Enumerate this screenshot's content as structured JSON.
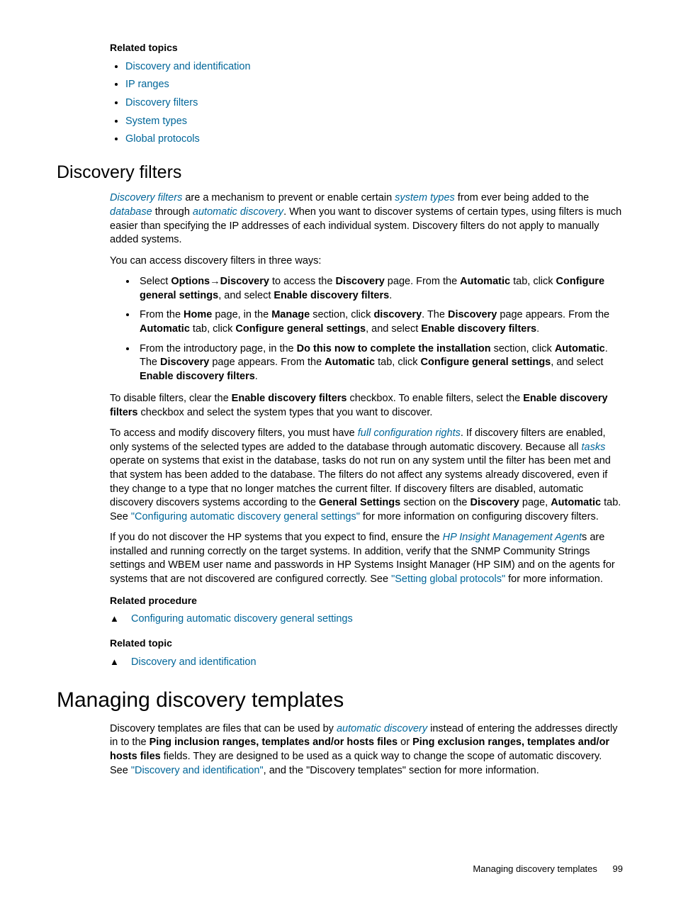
{
  "relatedTopicsHead": "Related topics",
  "topics": {
    "t0": "Discovery and identification",
    "t1": "IP ranges",
    "t2": "Discovery filters",
    "t3": "System types",
    "t4": "Global protocols"
  },
  "h_discoveryFilters": "Discovery filters",
  "df": {
    "p1_pre": "",
    "g_discoveryFilters": "Discovery filters",
    "p1_a": " are a mechanism to prevent or enable certain ",
    "g_systemTypes": "system types",
    "p1_b": " from ever being added to the ",
    "g_database": "database",
    "p1_c": " through ",
    "g_autoDisc": "automatic discovery",
    "p1_d": ". When you want to discover systems of certain types, using filters is much easier than specifying the IP addresses of each individual system. Discovery filters do not apply to manually added systems.",
    "p2": "You can access discovery filters in three ways:",
    "li1_a": "Select ",
    "li1_b1": "Options",
    "li1_arrow": "→",
    "li1_b2": "Discovery",
    "li1_c": " to access the ",
    "li1_b3": "Discovery",
    "li1_d": " page. From the ",
    "li1_b4": "Automatic",
    "li1_e": " tab, click ",
    "li1_b5": "Configure general settings",
    "li1_f": ", and select ",
    "li1_b6": "Enable discovery filters",
    "li1_g": ".",
    "li2_a": "From the ",
    "li2_b1": "Home",
    "li2_b": " page, in the ",
    "li2_b2": "Manage",
    "li2_c": " section, click ",
    "li2_b3": "discovery",
    "li2_d": ". The ",
    "li2_b4": "Discovery",
    "li2_e": " page appears. From the ",
    "li2_b5": "Automatic",
    "li2_f": " tab, click ",
    "li2_b6": "Configure general settings",
    "li2_g": ", and select ",
    "li2_b7": "Enable discovery filters",
    "li2_h": ".",
    "li3_a": "From the introductory page, in the ",
    "li3_b1": "Do this now to complete the installation",
    "li3_b": " section, click ",
    "li3_b2": "Automatic",
    "li3_c": ". The ",
    "li3_b3": "Discovery",
    "li3_d": " page appears. From the ",
    "li3_b4": "Automatic",
    "li3_e": " tab, click ",
    "li3_b5": "Configure general settings",
    "li3_f": ", and select ",
    "li3_b6": "Enable discovery filters",
    "li3_g": ".",
    "p3_a": "To disable filters, clear the ",
    "p3_b1": "Enable discovery filters",
    "p3_b": " checkbox. To enable filters, select the ",
    "p3_b2": "Enable discovery filters",
    "p3_c": " checkbox and select the system types that you want to discover.",
    "p4_a": "To access and modify discovery filters, you must have ",
    "p4_g1": "full configuration rights",
    "p4_b": ". If discovery filters are enabled, only systems of the selected types are added to the database through automatic discovery. Because all ",
    "p4_g2": "tasks",
    "p4_c": " operate on systems that exist in the database, tasks do not run on any system until the filter has been met and that system has been added to the database. The filters do not affect any systems already discovered, even if they change to a type that no longer matches the current filter. If discovery filters are disabled, automatic discovery discovers systems according to the ",
    "p4_b1": "General Settings",
    "p4_d": " section on the ",
    "p4_b2": "Discovery",
    "p4_e": " page, ",
    "p4_b3": "Automatic",
    "p4_f": " tab. See ",
    "p4_link": "\"Configuring automatic discovery general settings\"",
    "p4_g": " for more information on configuring discovery filters.",
    "p5_a": "If you do not discover the HP systems that you expect to find, ensure the ",
    "p5_g1": "HP Insight Management Agent",
    "p5_b": "s are installed and running correctly on the target systems. In addition, verify that the SNMP Community Strings settings and WBEM user name and passwords in HP Systems Insight Manager (HP SIM) and on the agents for systems that are not discovered are configured correctly. See ",
    "p5_link": "\"Setting global protocols\"",
    "p5_c": " for more information."
  },
  "relProcHead": "Related procedure",
  "relProcItem": "Configuring automatic discovery general settings",
  "relTopicHead": "Related topic",
  "relTopicItem": "Discovery and identification",
  "h_manage": "Managing discovery templates",
  "mt": {
    "p1_a": "Discovery templates are files that can be used by ",
    "p1_g1": "automatic discovery",
    "p1_b": " instead of entering the addresses directly in to the ",
    "p1_b1": "Ping inclusion ranges, templates and/or hosts files",
    "p1_c": " or ",
    "p1_b2": "Ping exclusion ranges, templates and/or hosts files",
    "p1_d": " fields. They are designed to be used as a quick way to change the scope of automatic discovery. See ",
    "p1_link": "\"Discovery and identification\"",
    "p1_e": ", and the \"Discovery templates\" section for more information."
  },
  "footerText": "Managing discovery templates",
  "pageNum": "99"
}
